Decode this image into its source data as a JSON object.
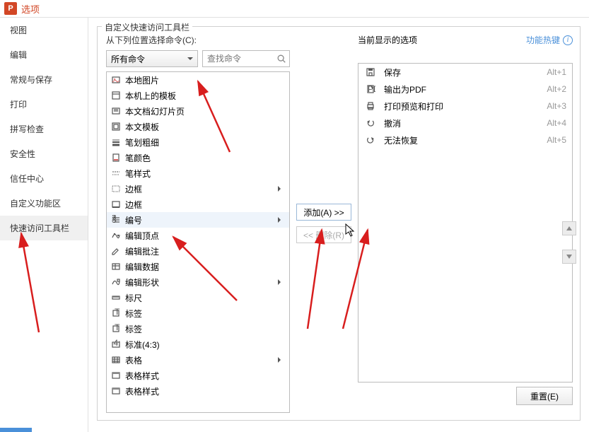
{
  "title": "选项",
  "sidebar": {
    "items": [
      {
        "label": "视图"
      },
      {
        "label": "编辑"
      },
      {
        "label": "常规与保存"
      },
      {
        "label": "打印"
      },
      {
        "label": "拼写检查"
      },
      {
        "label": "安全性"
      },
      {
        "label": "信任中心"
      },
      {
        "label": "自定义功能区"
      },
      {
        "label": "快速访问工具栏"
      }
    ],
    "selected_index": 8
  },
  "fieldset_title": "自定义快速访问工具栏",
  "left": {
    "choose_label": "从下列位置选择命令(C):",
    "combo_value": "所有命令",
    "search_placeholder": "查找命令",
    "items": [
      {
        "icon": "image",
        "label": "本地图片"
      },
      {
        "icon": "template",
        "label": "本机上的模板"
      },
      {
        "icon": "slides",
        "label": "本文档幻灯片页"
      },
      {
        "icon": "template2",
        "label": "本文模板"
      },
      {
        "icon": "stroke",
        "label": "笔划粗细"
      },
      {
        "icon": "color",
        "label": "笔颜色"
      },
      {
        "icon": "style",
        "label": "笔样式"
      },
      {
        "icon": "border",
        "label": "边框",
        "arrow": true
      },
      {
        "icon": "border2",
        "label": "边框"
      },
      {
        "icon": "number",
        "label": "编号",
        "arrow": true,
        "hl": true
      },
      {
        "icon": "vertex",
        "label": "编辑顶点"
      },
      {
        "icon": "annotate",
        "label": "编辑批注"
      },
      {
        "icon": "data",
        "label": "编辑数据"
      },
      {
        "icon": "shape",
        "label": "编辑形状",
        "arrow": true
      },
      {
        "icon": "ruler",
        "label": "标尺"
      },
      {
        "icon": "tag",
        "label": "标签"
      },
      {
        "icon": "tag",
        "label": "标签"
      },
      {
        "icon": "ratio",
        "label": "标准(4:3)"
      },
      {
        "icon": "table",
        "label": "表格",
        "arrow": true
      },
      {
        "icon": "tablestyle",
        "label": "表格样式"
      },
      {
        "icon": "tablestyle",
        "label": "表格样式"
      }
    ]
  },
  "mid": {
    "add_label": "添加(A) >>",
    "remove_label": "<< 删除(R)"
  },
  "right": {
    "head_label": "当前显示的选项",
    "hotkey_label": "功能热键",
    "items": [
      {
        "icon": "save",
        "label": "保存",
        "key": "Alt+1"
      },
      {
        "icon": "pdf",
        "label": "输出为PDF",
        "key": "Alt+2"
      },
      {
        "icon": "print",
        "label": "打印预览和打印",
        "key": "Alt+3"
      },
      {
        "icon": "undo",
        "label": "撤消",
        "key": "Alt+4"
      },
      {
        "icon": "redo",
        "label": "无法恢复",
        "key": "Alt+5"
      }
    ],
    "reset_label": "重置(E)"
  }
}
